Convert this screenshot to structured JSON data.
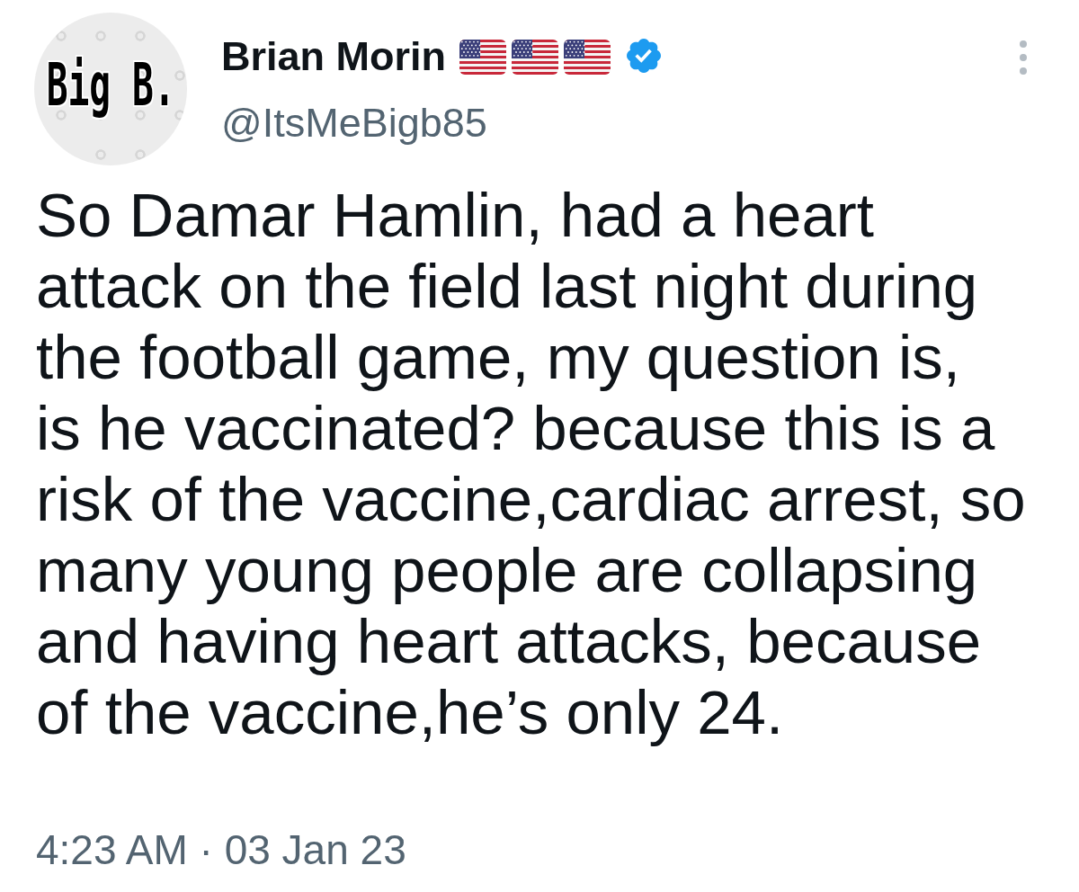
{
  "author": {
    "avatar": {
      "text": "Big B."
    },
    "name": "Brian Morin",
    "name_badges": [
      {
        "kind": "flag"
      },
      {
        "kind": "flag"
      },
      {
        "kind": "flag"
      },
      {
        "kind": "verified"
      }
    ],
    "handle": "@ItsMeBigb85"
  },
  "tweet": {
    "text": "So Damar Hamlin, had a heart\nattack on the field last night during\nthe football game, my question is,\nis he vaccinated? because this is a\nrisk of the vaccine,cardiac arrest, so\nmany young people are collapsing\nand having heart attacks, because\nof the vaccine,he’s only 24.",
    "time": "4:23 AM",
    "separator": "·",
    "date": "03 Jan 23"
  }
}
